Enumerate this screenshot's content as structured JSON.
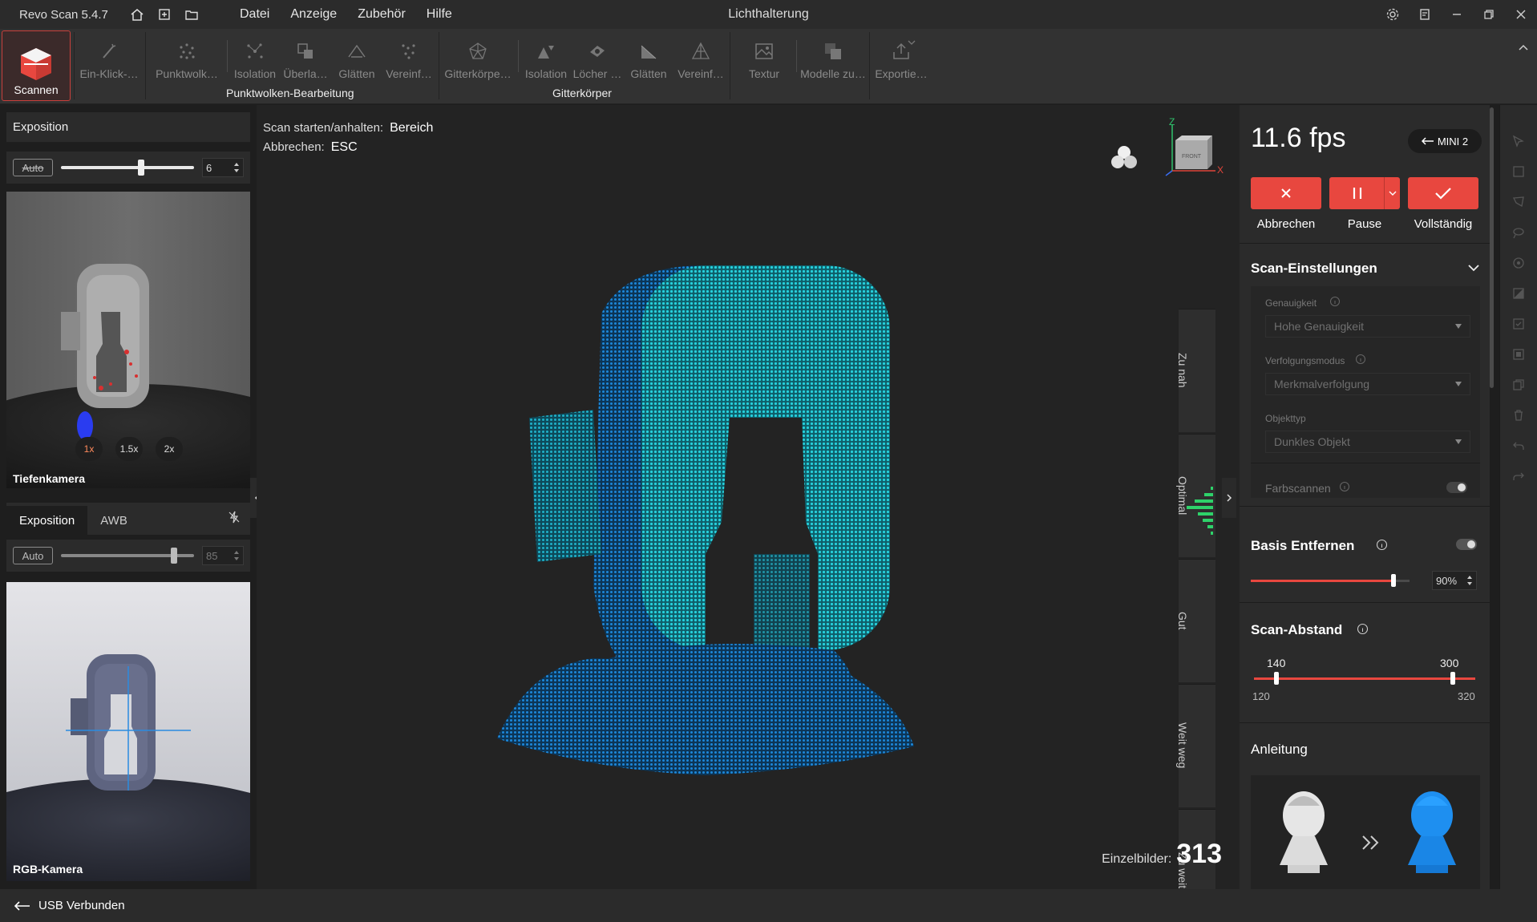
{
  "titlebar": {
    "app_name": "Revo Scan 5.4.7",
    "menu": [
      "Datei",
      "Anzeige",
      "Zubehör",
      "Hilfe"
    ],
    "window_title": "Lichthalterung"
  },
  "ribbon": {
    "scan_label": "Scannen",
    "tools": {
      "one_click": "Ein-Klick-…",
      "pointcloud": "Punktwolk…",
      "isolation": "Isolation",
      "overlap": "Überla…",
      "smooth": "Glätten",
      "simplify": "Vereinf…",
      "mesh": "Gitterkörpe…",
      "mesh_isolation": "Isolation",
      "holes": "Löcher …",
      "mesh_smooth": "Glätten",
      "mesh_simplify": "Vereinf…",
      "texture": "Textur",
      "models": "Modelle zu…",
      "export": "Exportie…"
    },
    "group_pointcloud": "Punktwolken-Bearbeitung",
    "group_mesh": "Gitterkörper"
  },
  "left": {
    "depth_header": "Exposition",
    "depth_auto": "Auto",
    "depth_value": "6",
    "depth_slider_fraction": 0.6,
    "depth_label": "Tiefenkamera",
    "zoom": [
      "1x",
      "1.5x",
      "2x"
    ],
    "tab_exposure": "Exposition",
    "tab_awb": "AWB",
    "rgb_auto": "Auto",
    "rgb_value": "85",
    "rgb_slider_fraction": 0.85,
    "rgb_label": "RGB-Kamera"
  },
  "viewport": {
    "hint1_label": "Scan starten/anhalten:",
    "hint1_key": "Bereich",
    "hint2_label": "Abbrechen:",
    "hint2_key": "ESC",
    "cube_label": "FRONT",
    "axis_z": "Z",
    "axis_x": "X",
    "quality": [
      "Zu nah",
      "Optimal",
      "Gut",
      "Weit weg",
      "Zu weit"
    ],
    "frames_label": "Einzelbilder:",
    "frames_value": "313"
  },
  "right": {
    "fps": "11.6 fps",
    "device": "MINI 2",
    "cancel": "Abbrechen",
    "pause": "Pause",
    "complete": "Vollständig",
    "settings_title": "Scan-Einstellungen",
    "accuracy_label": "Genauigkeit",
    "accuracy_value": "Hohe Genauigkeit",
    "tracking_label": "Verfolgungsmodus",
    "tracking_value": "Merkmalverfolgung",
    "object_label": "Objekttyp",
    "object_value": "Dunkles Objekt",
    "color_scan": "Farbscannen",
    "base_title": "Basis Entfernen",
    "base_value": "90%",
    "distance_title": "Scan-Abstand",
    "distance_low": "140",
    "distance_high": "300",
    "distance_min": "120",
    "distance_max": "320",
    "guide_title": "Anleitung"
  },
  "status": {
    "text": "USB Verbunden"
  },
  "colors": {
    "accent": "#e8473f",
    "scan_cyan": "#1fc7d6",
    "scan_blue": "#1a7fd8"
  }
}
